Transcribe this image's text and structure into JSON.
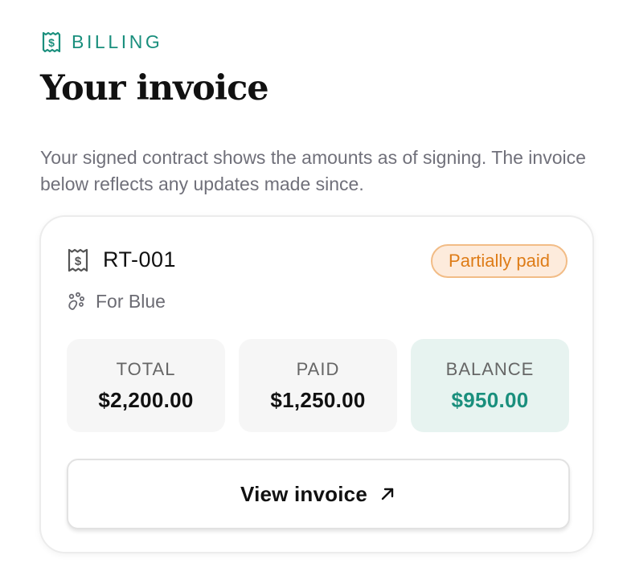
{
  "header": {
    "eyebrow": "BILLING",
    "title": "Your invoice",
    "description": "Your signed contract shows the amounts as of signing. The invoice below reflects any updates made since."
  },
  "invoice": {
    "id": "RT-001",
    "status": "Partially paid",
    "client": "For Blue",
    "stats": {
      "total_label": "TOTAL",
      "total_value": "$2,200.00",
      "paid_label": "PAID",
      "paid_value": "$1,250.00",
      "balance_label": "BALANCE",
      "balance_value": "$950.00"
    },
    "button_label": "View invoice"
  },
  "icons": {
    "eyebrow": "receipt-icon",
    "invoice": "receipt-icon",
    "client": "paw-icon",
    "button": "arrow-up-right-icon"
  },
  "colors": {
    "accent": "#1a8f7d",
    "status_text": "#de7c17",
    "status_bg": "#fdebdc",
    "status_border": "#f2bc86",
    "balance_bg": "#e7f3f0"
  }
}
